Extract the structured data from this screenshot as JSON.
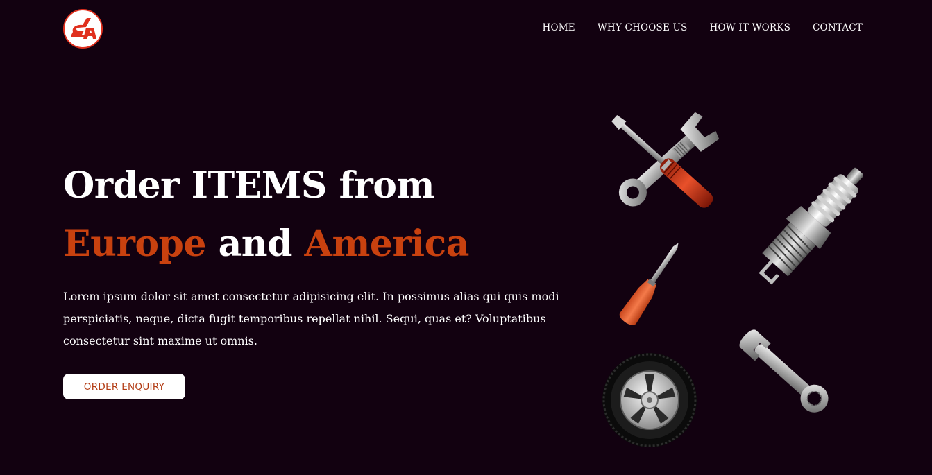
{
  "header": {
    "logo_text": "SA",
    "nav": [
      {
        "label": "HOME"
      },
      {
        "label": "WHY CHOOSE US"
      },
      {
        "label": "HOW IT WORKS"
      },
      {
        "label": "CONTACT"
      }
    ]
  },
  "hero": {
    "title_line1": "Order ITEMS from",
    "title_word1": "Europe",
    "title_and": "and",
    "title_word2": "America",
    "description": "Lorem ipsum dolor sit amet consectetur adipisicing elit. In possimus alias qui quis modi perspiciatis, neque, dicta fugit temporibus repellat nihil. Sequi, quas et? Voluptatibus consectetur sint maxime ut omnis.",
    "cta_label": "ORDER ENQUIRY"
  },
  "colors": {
    "background": "#120110",
    "accent": "#c8410f",
    "cta_text": "#b23a12"
  },
  "icons": [
    "logo-icon",
    "crossed-tools-icon",
    "spark-plug-icon",
    "screwdriver-icon",
    "wrench-icon",
    "tire-icon"
  ]
}
